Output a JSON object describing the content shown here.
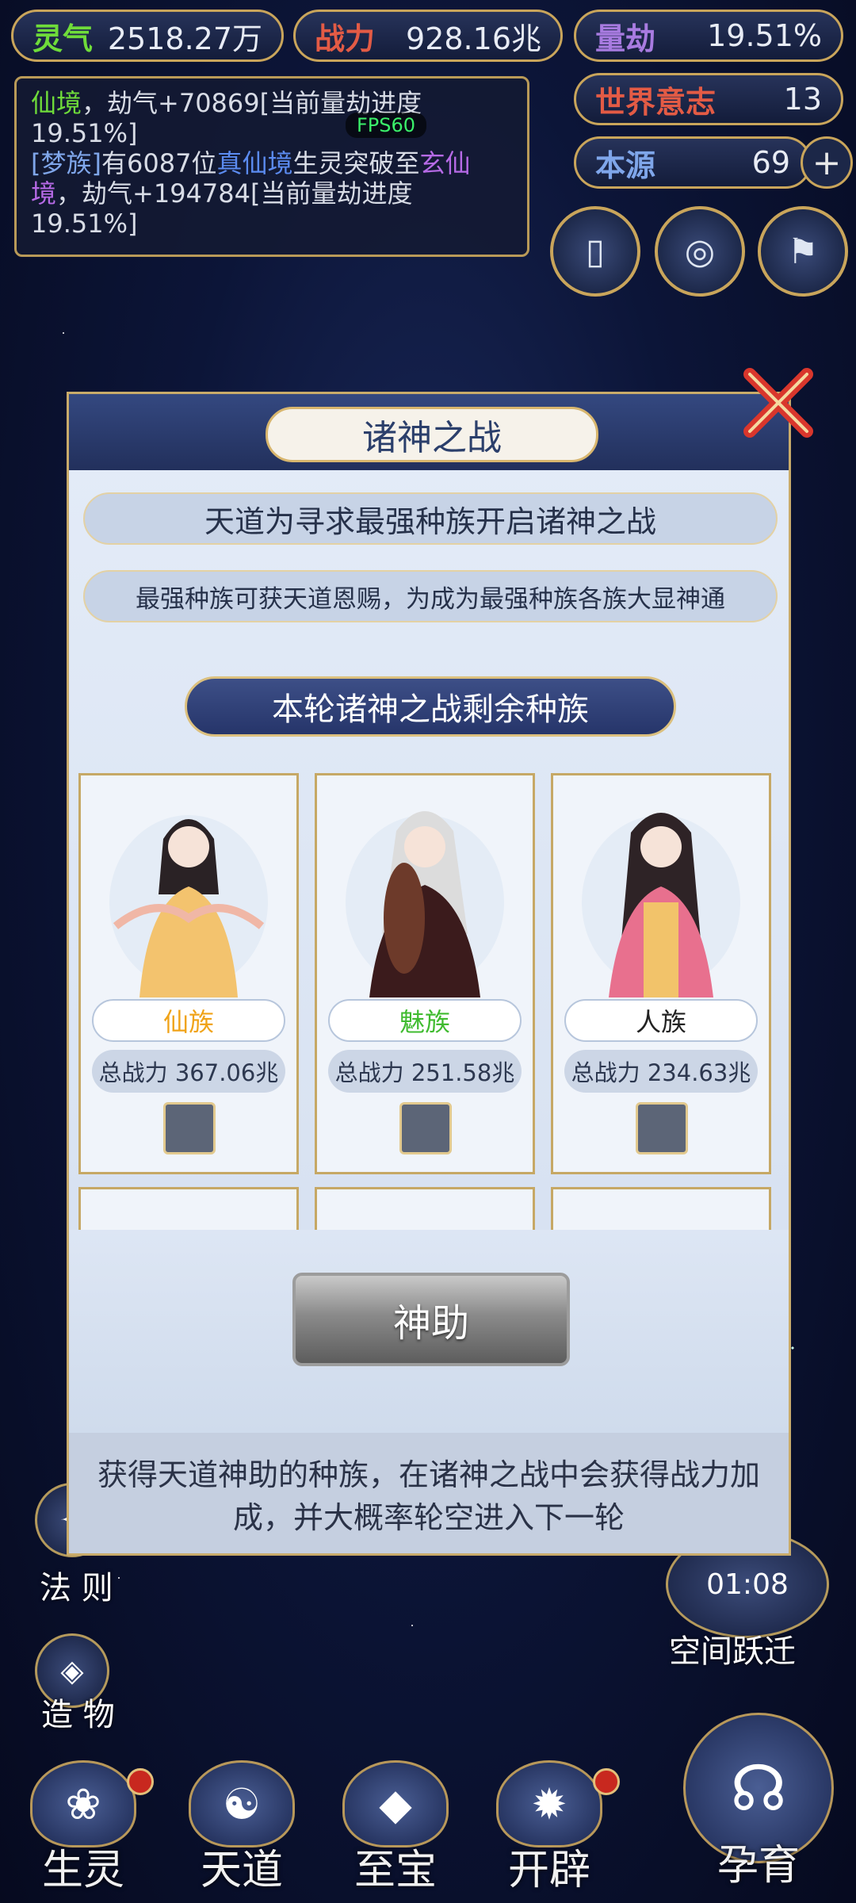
{
  "top_stats": {
    "lingqi": {
      "label": "灵气",
      "value": "2518.27万",
      "color": "#6fdc3a"
    },
    "zhanli": {
      "label": "战力",
      "value": "928.16兆",
      "color": "#e35b45"
    },
    "liangjie": {
      "label": "量劫",
      "value": "19.51%",
      "color": "#a87be0"
    },
    "world_will": {
      "label": "世界意志",
      "value": "13",
      "color": "#e35b45"
    },
    "origin": {
      "label": "本源",
      "value": "69",
      "color": "#7fa6ea"
    }
  },
  "log": {
    "line1_prefix": "仙境",
    "line1_text": "，劫气+70869[当前量劫进度19.51%]",
    "line2_race": "[梦族]",
    "line2_a": "有6087位",
    "line2_realm1": "真仙境",
    "line2_b": "生灵突破至",
    "line2_realm2": "玄仙境",
    "line2_c": "，劫气+194784[当前量劫进度19.51%]"
  },
  "fps": "FPS60",
  "timer": "01:08",
  "left_menu": {
    "fa_ze": "法 则",
    "zao_wu": "造 物"
  },
  "right_menu": {
    "kong_jian": "空间跃迁"
  },
  "dialog": {
    "title": "诸神之战",
    "intro": "天道为寻求最强种族开启诸神之战",
    "subtitle": "最强种族可获天道恩赐，为成为最强种族各族大显神通",
    "banner": "本轮诸神之战剩余种族",
    "cards": [
      {
        "race": "仙族",
        "race_color": "#f0a318",
        "power": "总战力 367.06兆"
      },
      {
        "race": "魅族",
        "race_color": "#3fbb2f",
        "power": "总战力 251.58兆"
      },
      {
        "race": "人族",
        "race_color": "#222222",
        "power": "总战力 234.63兆"
      }
    ],
    "help_button": "神助",
    "description": "获得天道神助的种族，在诸神之战中会获得战力加成，并大概率轮空进入下一轮"
  },
  "bottom_nav": [
    {
      "label": "生灵",
      "icon": "lotus-icon"
    },
    {
      "label": "天道",
      "icon": "swirl-icon"
    },
    {
      "label": "至宝",
      "icon": "treasure-icon"
    },
    {
      "label": "开辟",
      "icon": "flame-icon"
    },
    {
      "label": "孕育",
      "icon": "embryo-icon"
    }
  ]
}
